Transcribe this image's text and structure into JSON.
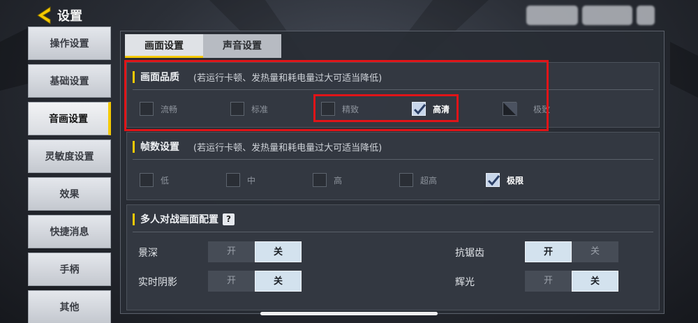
{
  "header": {
    "title": "设置"
  },
  "sidebar": {
    "items": [
      {
        "label": "操作设置"
      },
      {
        "label": "基础设置"
      },
      {
        "label": "音画设置"
      },
      {
        "label": "灵敏度设置"
      },
      {
        "label": "效果"
      },
      {
        "label": "快捷消息"
      },
      {
        "label": "手柄"
      },
      {
        "label": "其他"
      }
    ],
    "active_index": 2
  },
  "tabs": [
    {
      "label": "画面设置",
      "active": true
    },
    {
      "label": "声音设置",
      "active": false
    }
  ],
  "quality": {
    "title": "画面品质",
    "note": "(若运行卡顿、发热量和耗电量过大可适当降低)",
    "options": [
      {
        "label": "流畅",
        "checked": false
      },
      {
        "label": "标准",
        "checked": false
      },
      {
        "label": "精致",
        "checked": false
      },
      {
        "label": "高清",
        "checked": true
      },
      {
        "label": "极致",
        "checked": false
      }
    ]
  },
  "fps": {
    "title": "帧数设置",
    "note": "(若运行卡顿、发热量和耗电量过大可适当降低)",
    "options": [
      {
        "label": "低",
        "checked": false
      },
      {
        "label": "中",
        "checked": false
      },
      {
        "label": "高",
        "checked": false
      },
      {
        "label": "超高",
        "checked": false
      },
      {
        "label": "极限",
        "checked": true
      }
    ]
  },
  "multiplayer": {
    "title": "多人对战画面配置",
    "help": "?",
    "on_label": "开",
    "off_label": "关",
    "settings": [
      {
        "label": "景深",
        "value": "关"
      },
      {
        "label": "实时阴影",
        "value": "关"
      },
      {
        "label": "抗锯齿",
        "value": "开"
      },
      {
        "label": "辉光",
        "value": "关"
      }
    ]
  },
  "colors": {
    "accent": "#f4c900",
    "highlight_box": "#e01418"
  }
}
